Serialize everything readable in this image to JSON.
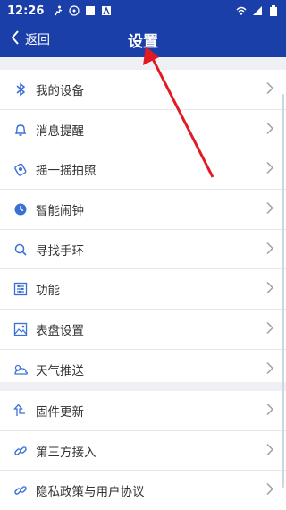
{
  "status": {
    "time": "12:26"
  },
  "nav": {
    "back": "返回",
    "title": "设置"
  },
  "groups": [
    {
      "items": [
        {
          "label": "我的设备",
          "icon": "bluetooth-icon"
        },
        {
          "label": "消息提醒",
          "icon": "bell-icon"
        },
        {
          "label": "摇一摇拍照",
          "icon": "shake-camera-icon"
        },
        {
          "label": "智能闹钟",
          "icon": "alarm-icon"
        },
        {
          "label": "寻找手环",
          "icon": "search-icon"
        },
        {
          "label": "功能",
          "icon": "settings-sliders-icon"
        },
        {
          "label": "表盘设置",
          "icon": "dial-image-icon"
        },
        {
          "label": "天气推送",
          "icon": "weather-icon"
        }
      ]
    },
    {
      "items": [
        {
          "label": "固件更新",
          "icon": "update-icon"
        },
        {
          "label": "第三方接入",
          "icon": "link-icon"
        },
        {
          "label": "隐私政策与用户协议",
          "icon": "policy-link-icon"
        }
      ]
    }
  ],
  "colors": {
    "accent": "#1a3fa8",
    "icon": "#3a6fd8",
    "annotation": "#e01b24"
  }
}
